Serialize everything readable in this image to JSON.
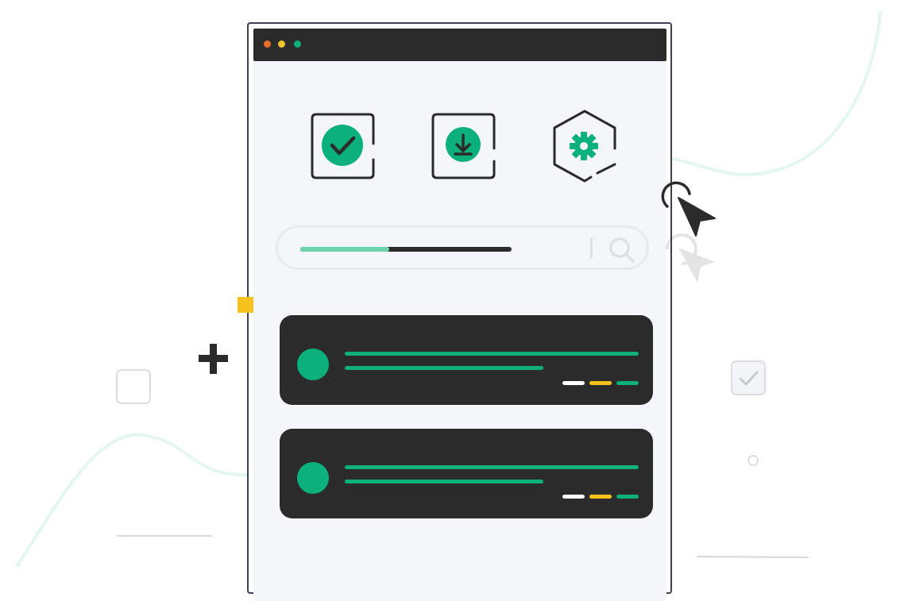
{
  "window": {
    "controls": [
      "close",
      "minimize",
      "maximize"
    ]
  },
  "toolbar_icons": [
    {
      "icon": "check-icon",
      "shape": "square"
    },
    {
      "icon": "download-icon",
      "shape": "square"
    },
    {
      "icon": "gear-icon",
      "shape": "hexagon"
    }
  ],
  "search": {
    "progress": 0.42,
    "icon": "search-icon"
  },
  "cards": [
    {
      "avatar": "avatar",
      "tags": [
        "white",
        "yellow",
        "green"
      ]
    },
    {
      "avatar": "avatar",
      "tags": [
        "white",
        "yellow",
        "green"
      ]
    }
  ],
  "colors": {
    "accent": "#0bb07b",
    "accent_light": "#6fd3b0",
    "dark": "#2b2b2b",
    "frame": "#3a4150",
    "content_bg": "#f5f6fa",
    "yellow": "#f6c21c",
    "orange": "#e8702a",
    "dot_yellow": "#f2c230"
  }
}
